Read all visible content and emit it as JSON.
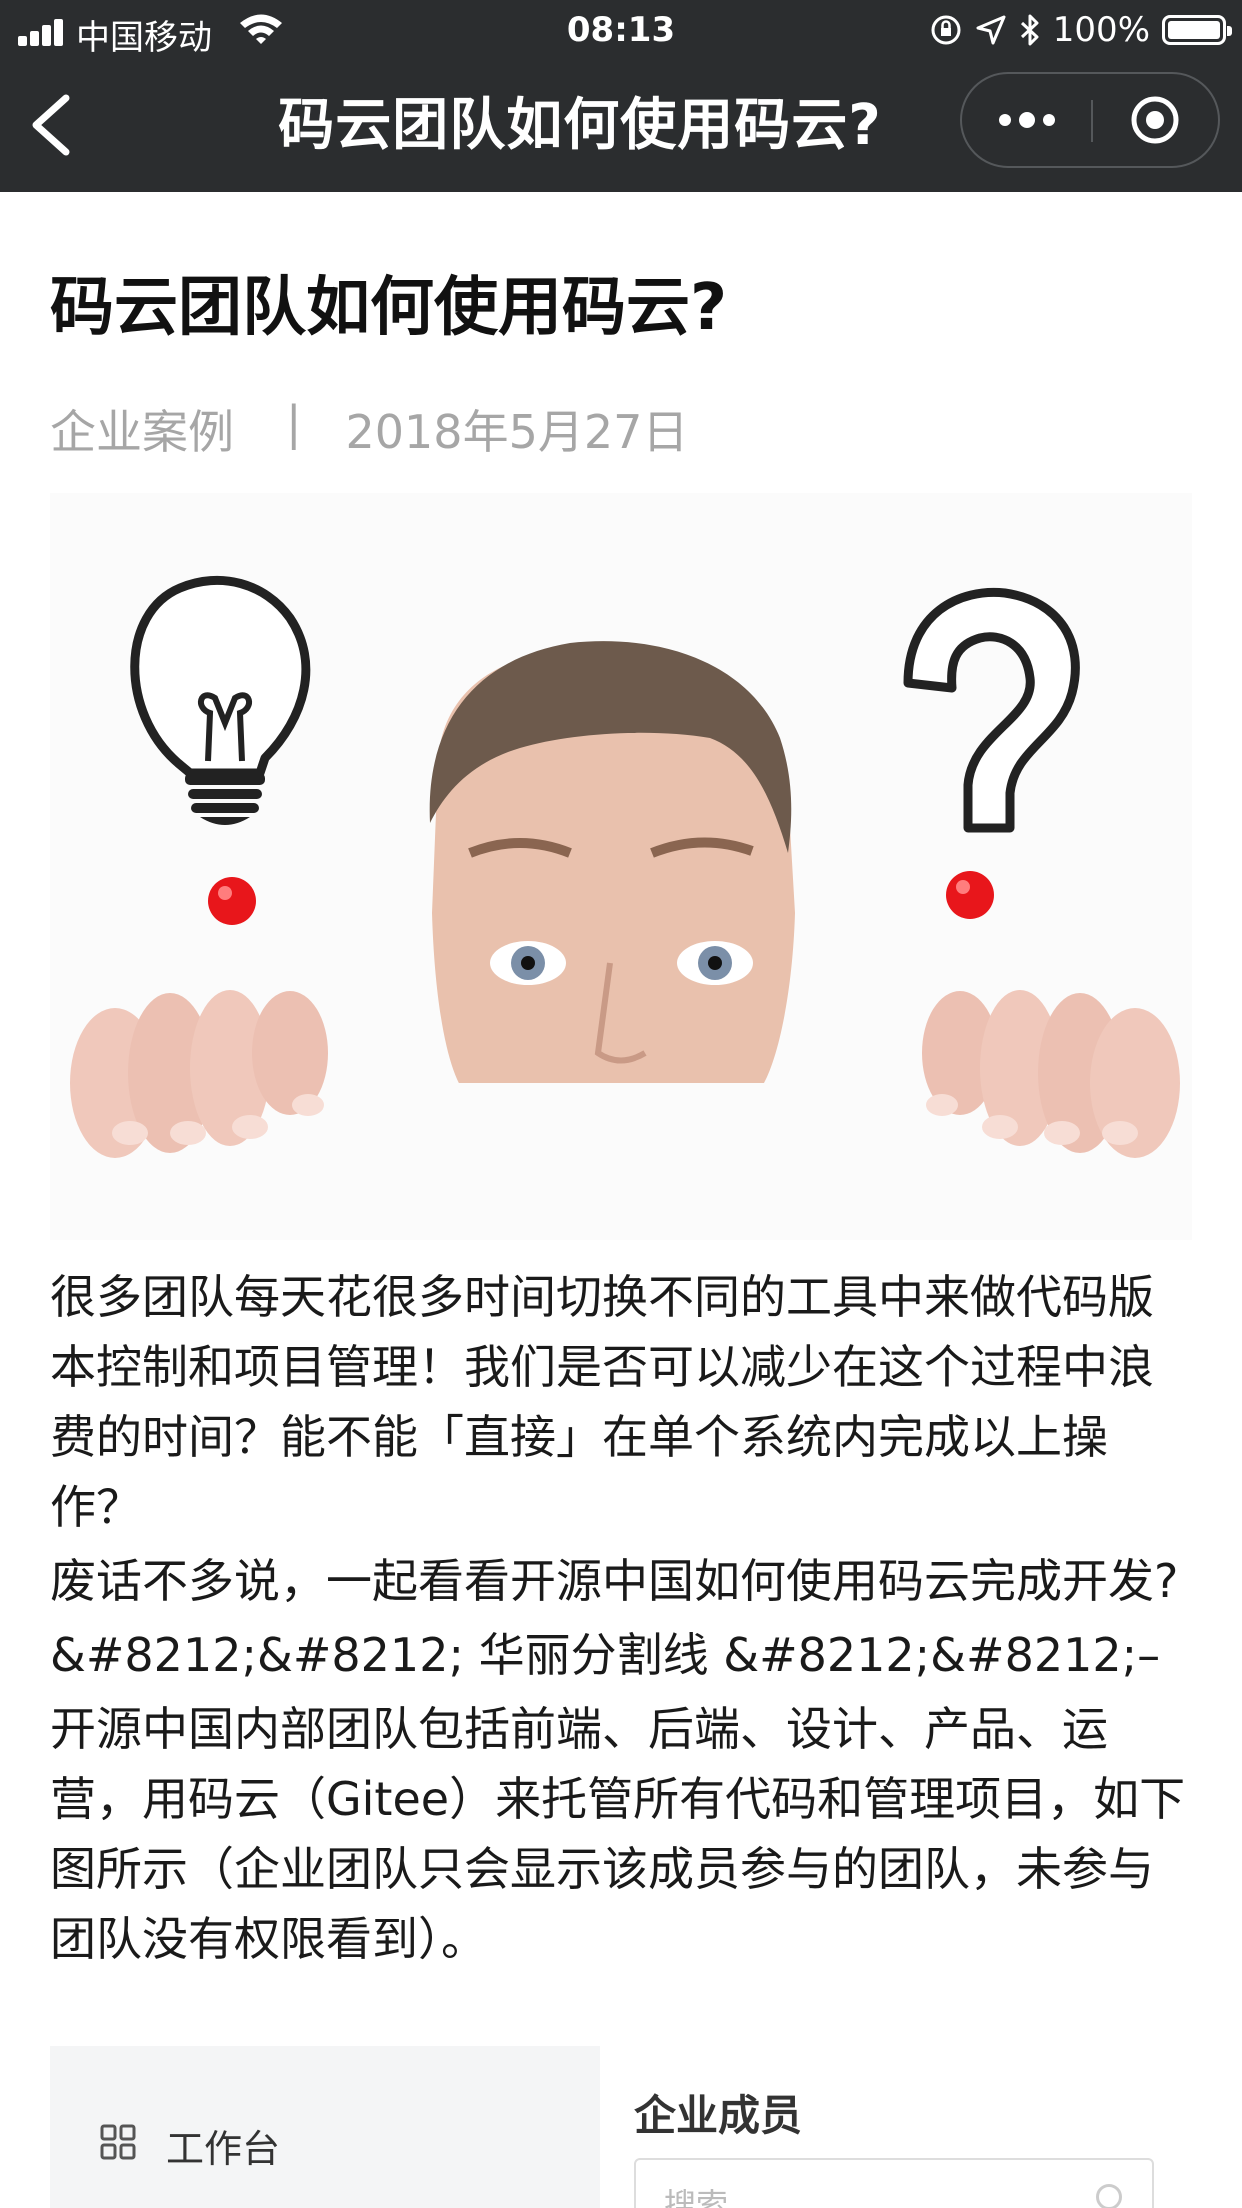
{
  "status_bar": {
    "carrier": "中国移动",
    "time": "08:13",
    "battery": "100%"
  },
  "nav": {
    "title": "码云团队如何使用码云?"
  },
  "article": {
    "title": "码云团队如何使用码云?",
    "category": "企业案例",
    "separator": "|",
    "date": "2018年5月27日",
    "paragraphs": [
      "很多团队每天花很多时间切换不同的工具中来做代码版本控制和项目管理！我们是否可以减少在这个过程中浪费的时间？能不能「直接」在单个系统内完成以上操作？",
      "废话不多说，一起看看开源中国如何使用码云完成开发?",
      "&#8212;&#8212; 华丽分割线 &#8212;&#8212;–",
      "开源中国内部团队包括前端、后端、设计、产品、运营，用码云（Gitee）来托管所有代码和管理项目，如下图所示（企业团队只会显示该成员参与的团队，未参与团队没有权限看到）。"
    ]
  },
  "embedded_screenshot": {
    "sidebar_item": "工作台",
    "section_title": "企业成员",
    "search_placeholder": "搜索..."
  },
  "colors": {
    "top_bar": "#2b2d2f",
    "meta_text": "#a6a6a6",
    "red_dot": "#e8161b"
  }
}
